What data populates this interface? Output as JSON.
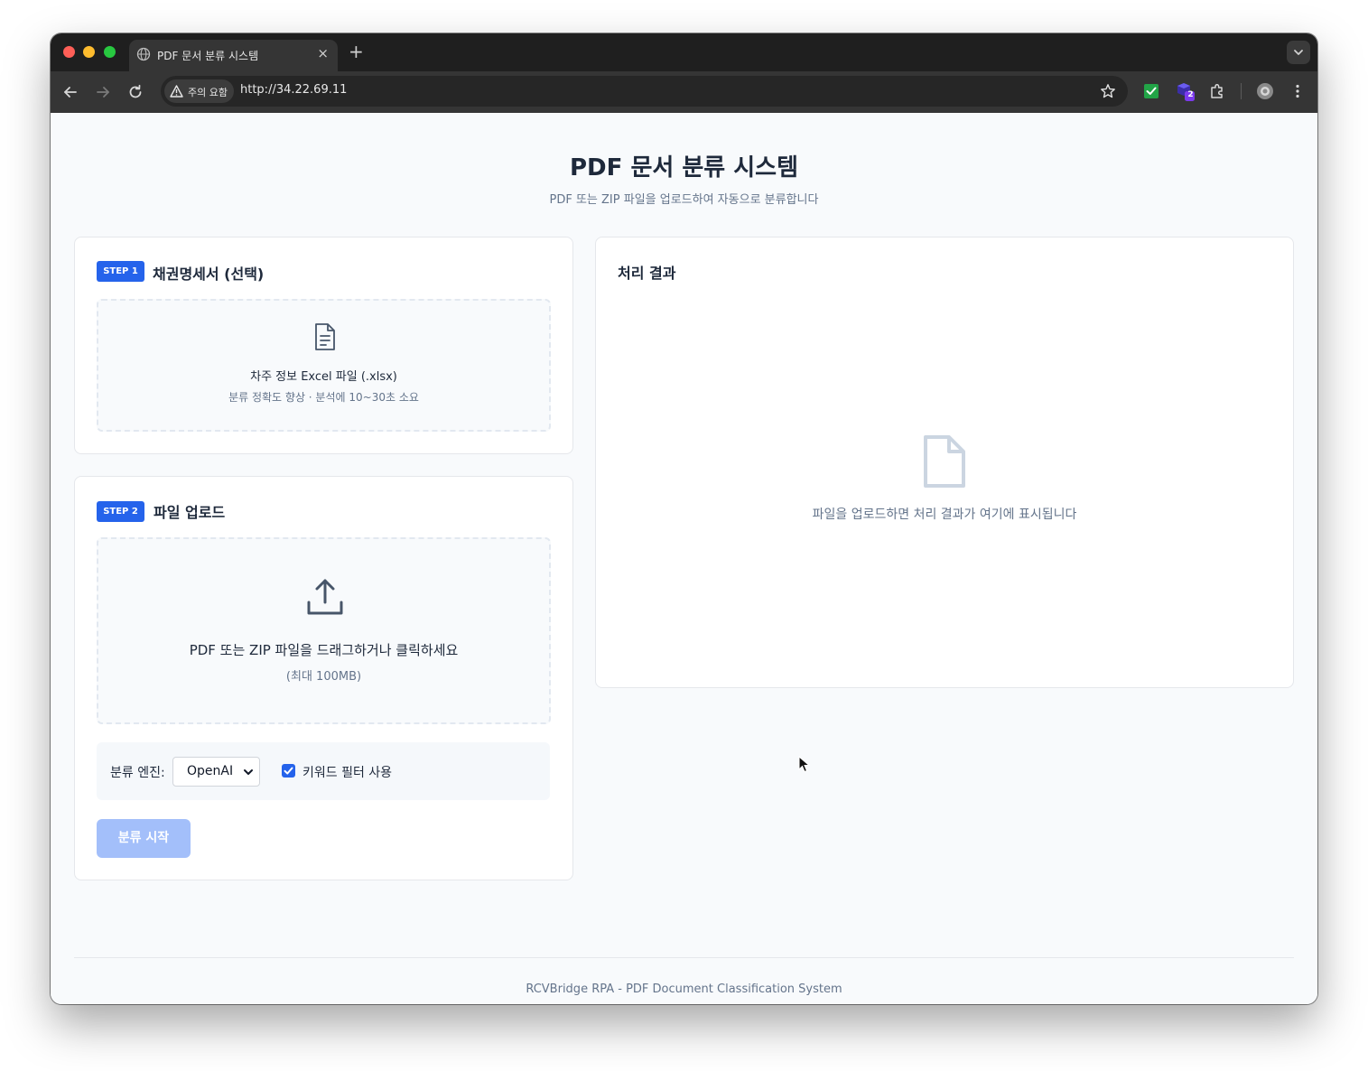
{
  "browser": {
    "tab_title": "PDF 문서 분류 시스템",
    "close_glyph": "×",
    "new_tab_glyph": "+",
    "security_chip": "주의 요함",
    "url": "http://34.22.69.11",
    "extension_badge_count": "2",
    "traffic_light_colors": [
      "#ff5f57",
      "#febc2e",
      "#28c840"
    ]
  },
  "page": {
    "title": "PDF 문서 분류 시스템",
    "subtitle": "PDF 또는 ZIP 파일을 업로드하여 자동으로 분류합니다"
  },
  "step1": {
    "badge": "STEP 1",
    "heading": "채권명세서 (선택)",
    "icon": "document-text-icon",
    "dropzone_title": "차주 정보 Excel 파일 (.xlsx)",
    "dropzone_hint": "분류 정확도 향상 · 분석에 10~30초 소요"
  },
  "step2": {
    "badge": "STEP 2",
    "heading": "파일 업로드",
    "icon": "upload-icon",
    "dropzone_title": "PDF 또는 ZIP 파일을 드래그하거나 클릭하세요",
    "dropzone_hint": "(최대 100MB)",
    "engine_label": "분류 엔진:",
    "engine_value": "OpenAI",
    "keyword_filter_label": "키워드 필터 사용",
    "keyword_filter_checked": true,
    "start_button": "분류 시작"
  },
  "results": {
    "title": "처리 결과",
    "icon": "document-icon",
    "empty_message": "파일을 업로드하면 처리 결과가 여기에 표시됩니다"
  },
  "footer": {
    "text": "RCVBridge RPA - PDF Document Classification System"
  },
  "colors": {
    "accent": "#2563eb",
    "accent_disabled": "#a3bffa",
    "text_dark": "#1e293b",
    "text_muted": "#64748b"
  }
}
